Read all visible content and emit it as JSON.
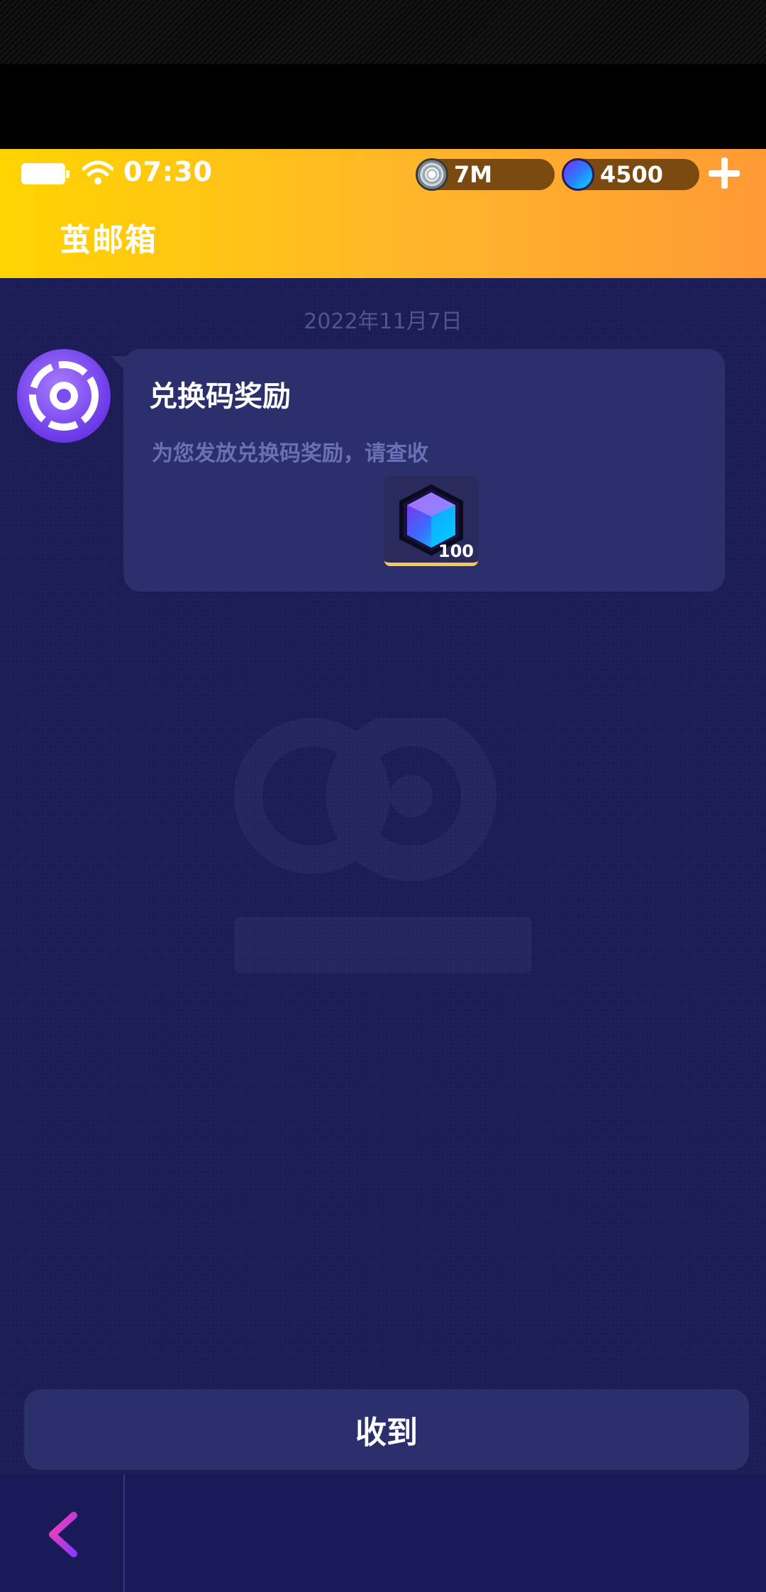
{
  "status_bar": {
    "time": "07:30"
  },
  "currency": {
    "coins": "7M",
    "gems": "4500"
  },
  "header": {
    "title": "邮箱",
    "title_prefix": "茧"
  },
  "mail": {
    "date": "2022年11月7日",
    "title": "兑换码奖励",
    "body": "为您发放兑换码奖励，请查收",
    "reward_count": "100"
  },
  "buttons": {
    "receive": "收到"
  },
  "icons": {
    "battery": "battery-icon",
    "wifi": "wifi-icon",
    "coin": "coin-icon",
    "gem": "gem-icon",
    "add": "plus-icon",
    "back": "chevron-left-icon",
    "avatar": "avatar-icon",
    "watermark": "cocos-logo"
  },
  "colors": {
    "header_start": "#ffd400",
    "header_end": "#ff9a35",
    "background": "#1c1c57",
    "card": "#2b2f6b",
    "accent_back": "#b040ff"
  }
}
